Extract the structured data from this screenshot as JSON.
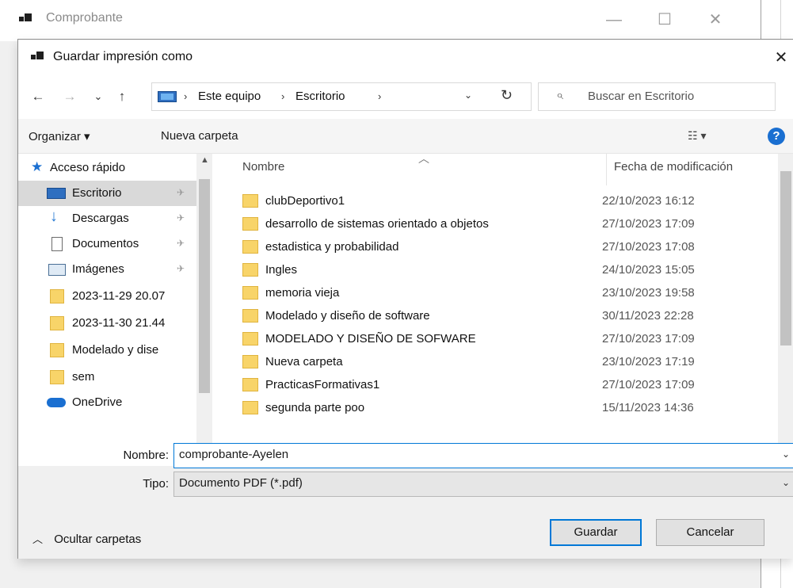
{
  "parent_window": {
    "title": "Comprobante",
    "minimize_glyph": "—",
    "maximize_glyph": "☐",
    "close_glyph": "✕"
  },
  "dialog": {
    "title": "Guardar impresión como",
    "close_glyph": "✕"
  },
  "nav": {
    "back_glyph": "←",
    "forward_glyph": "→",
    "recent_glyph": "⌄",
    "up_glyph": "↑",
    "breadcrumbs": [
      "Este equipo",
      "Escritorio"
    ],
    "crumb_separator": "›",
    "dropdown_glyph": "⌄",
    "refresh_glyph": "↻",
    "search_placeholder": "Buscar en Escritorio",
    "search_glyph": "⌕"
  },
  "toolbar": {
    "organize_label": "Organizar ▾",
    "new_folder_label": "Nueva carpeta",
    "view_glyph": "☷ ▾",
    "help_glyph": "?"
  },
  "navpane": {
    "quick_access_label": "Acceso rápido",
    "items": [
      {
        "label": "Escritorio",
        "icon": "desktop-icon",
        "pinned": true
      },
      {
        "label": "Descargas",
        "icon": "download-icon",
        "pinned": true
      },
      {
        "label": "Documentos",
        "icon": "documents-icon",
        "pinned": true
      },
      {
        "label": "Imágenes",
        "icon": "pictures-icon",
        "pinned": true
      },
      {
        "label": "2023-11-29 20.07",
        "icon": "folder-icon",
        "pinned": false
      },
      {
        "label": "2023-11-30 21.44",
        "icon": "folder-icon",
        "pinned": false
      },
      {
        "label": "Modelado y dise",
        "icon": "folder-icon",
        "pinned": false
      },
      {
        "label": "sem",
        "icon": "folder-icon",
        "pinned": false
      }
    ],
    "onedrive_label": "OneDrive",
    "pin_glyph": "✈"
  },
  "filelist": {
    "columns": {
      "name": "Nombre",
      "date": "Fecha de modificación"
    },
    "sort_glyph": "︿",
    "rows": [
      {
        "name": "clubDeportivo1",
        "date": "22/10/2023 16:12"
      },
      {
        "name": "desarrollo de sistemas orientado a objetos",
        "date": "27/10/2023 17:09"
      },
      {
        "name": "estadistica y probabilidad",
        "date": "27/10/2023 17:08"
      },
      {
        "name": "Ingles",
        "date": "24/10/2023 15:05"
      },
      {
        "name": "memoria vieja",
        "date": "23/10/2023 19:58"
      },
      {
        "name": "Modelado y diseño de software",
        "date": "30/11/2023 22:28"
      },
      {
        "name": "MODELADO Y DISEÑO DE SOFWARE",
        "date": "27/10/2023 17:09"
      },
      {
        "name": "Nueva carpeta",
        "date": "23/10/2023 17:19"
      },
      {
        "name": "PracticasFormativas1",
        "date": "27/10/2023 17:09"
      },
      {
        "name": "segunda parte poo",
        "date": "15/11/2023 14:36"
      }
    ]
  },
  "form": {
    "name_label": "Nombre:",
    "name_value": "comprobante-Ayelen",
    "type_label": "Tipo:",
    "type_value": "Documento PDF (*.pdf)",
    "hide_folders_label": "Ocultar carpetas",
    "hide_folders_glyph": "︿",
    "save_label": "Guardar",
    "cancel_label": "Cancelar"
  },
  "colors": {
    "accent": "#0078d7",
    "folder": "#f8d469",
    "selection": "#d9d9d9"
  }
}
